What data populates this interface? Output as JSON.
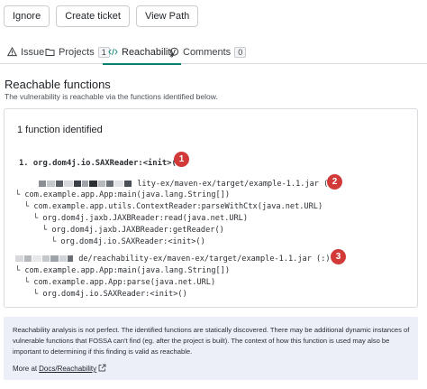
{
  "toolbar": {
    "ignore_label": "Ignore",
    "create_ticket_label": "Create ticket",
    "view_path_label": "View Path"
  },
  "tabs": [
    {
      "label": "Issue",
      "icon": "warning-icon"
    },
    {
      "label": "Projects",
      "icon": "folder-icon",
      "badge": "1"
    },
    {
      "label": "Reachability",
      "icon": "code-icon",
      "active": true
    },
    {
      "label": "Comments",
      "icon": "comment-icon",
      "badge": "0"
    }
  ],
  "section": {
    "title": "Reachable functions",
    "description": "The vulnerability is reachable via the functions identified below."
  },
  "panel": {
    "title": "1 function identified",
    "function": "1. org.dom4j.io.SAXReader:<init>()",
    "paths": [
      {
        "marker": "2",
        "jar": "lity-ex/maven-ex/target/example-1.1.jar (:)",
        "frames": [
          "com.example.app.App:main(java.lang.String[])",
          "com.example.app.utils.ContextReader:parseWithCtx(java.net.URL)",
          "org.dom4j.jaxb.JAXBReader:read(java.net.URL)",
          "org.dom4j.jaxb.JAXBReader:getReader()",
          "org.dom4j.io.SAXReader:<init>()"
        ]
      },
      {
        "marker": "3",
        "jar": "de/reachability-ex/maven-ex/target/example-1.1.jar (:)",
        "frames": [
          "com.example.app.App:main(java.lang.String[])",
          "com.example.app.App:parse(java.net.URL)",
          "org.dom4j.io.SAXReader:<init>()"
        ]
      }
    ],
    "function_marker": "1"
  },
  "note": {
    "text": "Reachability analysis is not perfect. The identified functions are statically discovered. There may be additional dynamic instances of vulnerable functions that FOSSA can't find (eg. after the project is built). The context of how this function is used may also be important to determining if this finding is valid as reachable.",
    "more_prefix": "More at",
    "link": "Docs/Reachability"
  },
  "colors": {
    "accent": "#0a7f6f",
    "marker": "#d23a3a",
    "note_bg": "#eceff7"
  }
}
